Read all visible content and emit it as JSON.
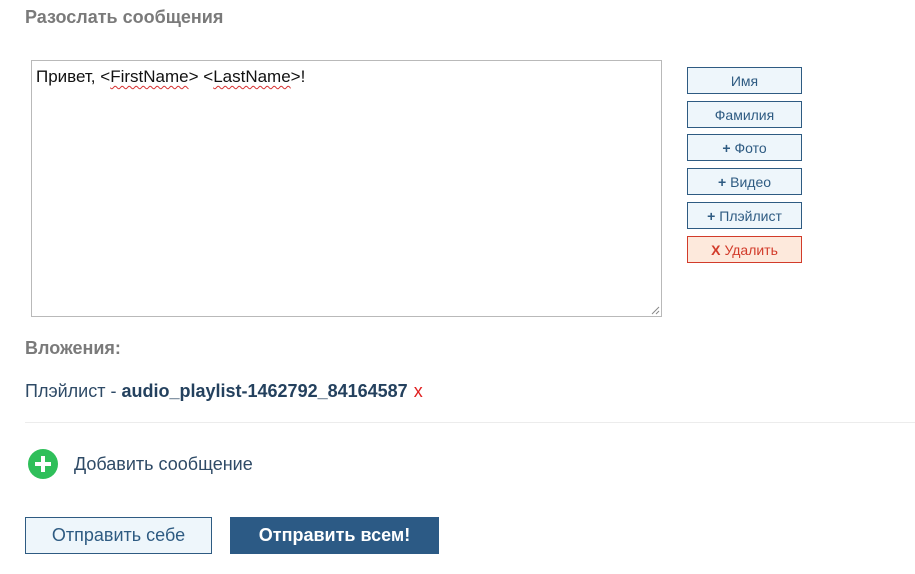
{
  "title": "Разослать сообщения",
  "editor": {
    "text_prefix": "Привет, <",
    "token_first": "FirstName",
    "text_mid": "> <",
    "token_last": "LastName",
    "text_suffix": ">!"
  },
  "side_buttons": {
    "first_name": "Имя",
    "last_name": "Фамилия",
    "photo": "Фото",
    "video": "Видео",
    "playlist": "Плэйлист",
    "delete": "Удалить",
    "plus_symbol": "+",
    "delete_symbol": "X"
  },
  "attachments": {
    "label": "Вложения:",
    "items": [
      {
        "type_label": "Плэйлист - ",
        "name": "audio_playlist-1462792_84164587",
        "remove_symbol": "x"
      }
    ]
  },
  "add_message_label": "Добавить сообщение",
  "buttons": {
    "send_self": "Отправить себе",
    "send_all": "Отправить всем!"
  },
  "colors": {
    "accent": "#2c5a85",
    "danger": "#d23b2a",
    "add_green": "#2fbf5a"
  }
}
